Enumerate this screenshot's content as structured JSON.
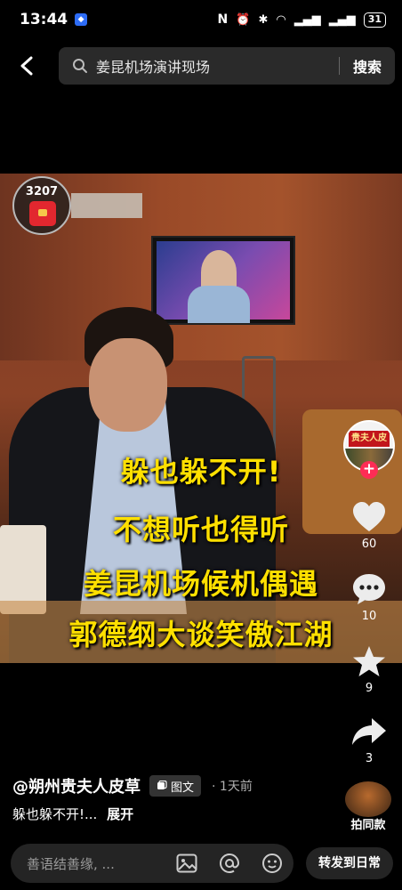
{
  "status_bar": {
    "time": "13:44",
    "battery": "31"
  },
  "search": {
    "query": "姜昆机场演讲现场",
    "button_label": "搜索"
  },
  "video": {
    "gift_count": "3207",
    "captions": [
      "躲也躲不开!",
      "不想听也得听",
      "姜昆机场候机偶遇",
      "郭德纲大谈笑傲江湖"
    ],
    "caption_color": "#ffe000"
  },
  "creator": {
    "avatar_text": "贵夫人皮草"
  },
  "actions": {
    "like_count": "60",
    "comment_count": "10",
    "favorite_count": "9",
    "share_count": "3"
  },
  "post": {
    "author": "@朔州贵夫人皮草",
    "type_tag": "图文",
    "time_ago": "· 1天前",
    "description": "躲也躲不开!...",
    "expand_label": "展开",
    "same_style_label": "拍同款"
  },
  "bottom_bar": {
    "comment_placeholder": "善语结善缘, ...",
    "share_daily_label": "转发到日常"
  },
  "colors": {
    "accent": "#fe2c55",
    "background": "#000000"
  },
  "icons": [
    "back-icon",
    "search-icon",
    "heart-icon",
    "comment-icon",
    "star-icon",
    "share-icon",
    "image-icon",
    "at-icon",
    "emoji-icon"
  ]
}
